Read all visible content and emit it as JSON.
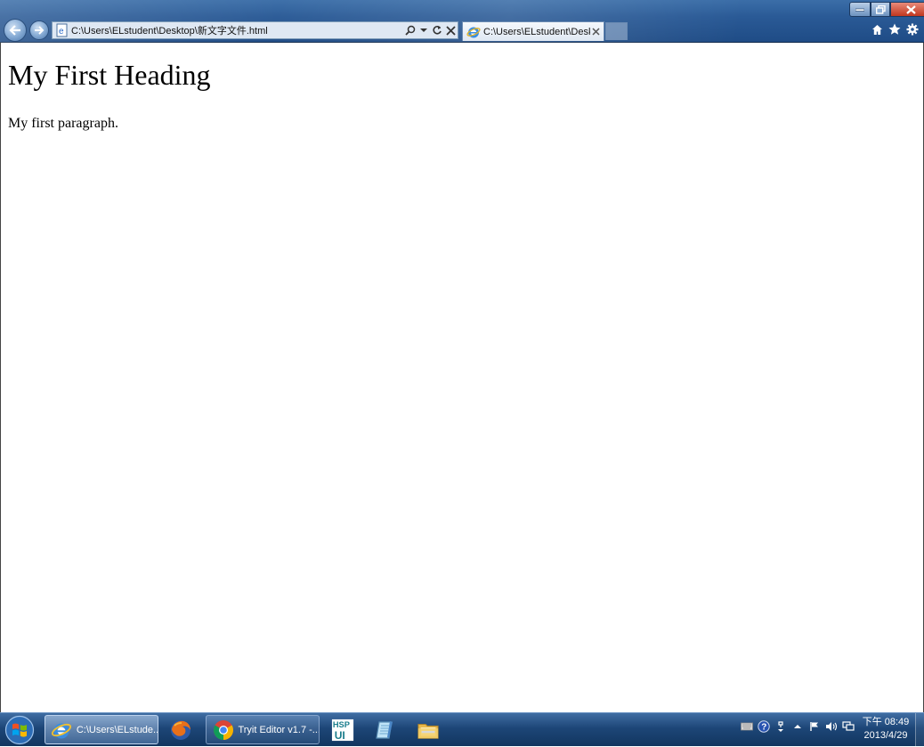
{
  "browser": {
    "address_url": "C:\\Users\\ELstudent\\Desktop\\新文字文件.html",
    "tab_title": "C:\\Users\\ELstudent\\Deskt...",
    "tools": [
      "search-icon",
      "dropdown-icon",
      "refresh-icon",
      "stop-icon"
    ],
    "right_tools": [
      "home-icon",
      "favorites-star-icon",
      "tools-gear-icon"
    ]
  },
  "page": {
    "heading": "My First Heading",
    "paragraph": "My first paragraph."
  },
  "taskbar": {
    "items": [
      {
        "label": "C:\\Users\\ELstude...",
        "icon": "internet-explorer-icon"
      },
      {
        "label": "",
        "icon": "firefox-icon"
      },
      {
        "label": "Tryit Editor v1.7 -...",
        "icon": "chrome-icon"
      },
      {
        "label": "",
        "icon": "hsp-ui-icon",
        "icon_text": "HSP UI"
      },
      {
        "label": "",
        "icon": "notepad-icon"
      },
      {
        "label": "",
        "icon": "file-explorer-icon"
      }
    ],
    "clock": {
      "time": "下午 08:49",
      "date": "2013/4/29"
    }
  },
  "colors": {
    "titlebar": "#2a5a96",
    "taskbar": "#1d4677",
    "close_button": "#c2371f"
  }
}
